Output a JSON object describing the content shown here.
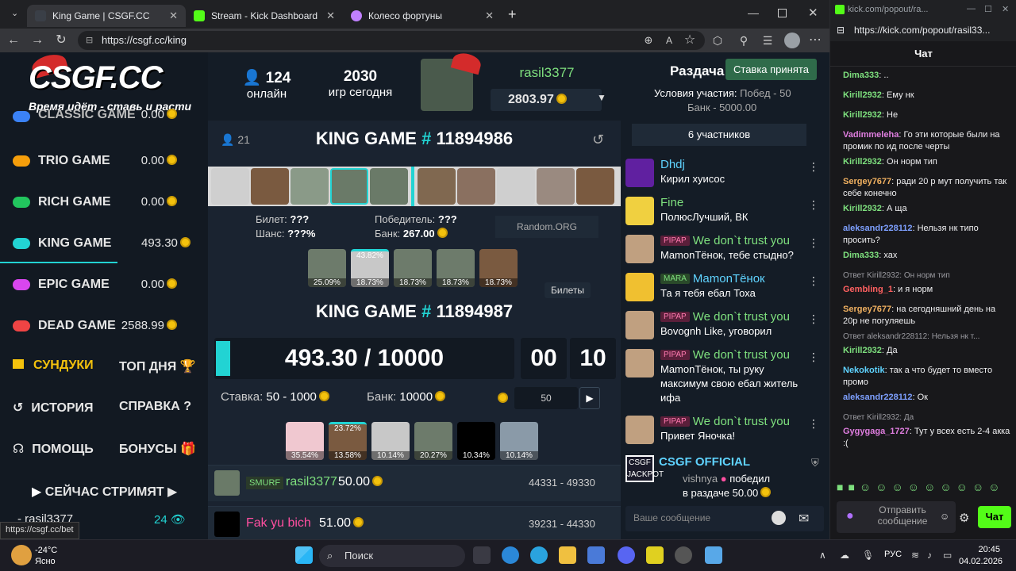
{
  "browser": {
    "tabs": [
      {
        "title": "King Game | CSGF.CC",
        "active": true
      },
      {
        "title": "Stream - Kick Dashboard",
        "active": false
      },
      {
        "title": "Колесо фортуны",
        "active": false
      }
    ],
    "url": "https://csgf.cc/king",
    "status_url": "https://csgf.cc/bet"
  },
  "sidebar": {
    "logo": "CSGF.CC",
    "logo_sub": "Время идёт - ставь и расти",
    "items": [
      {
        "label": "CLASSIC GAME",
        "value": "0.00",
        "color": "#3b82f6"
      },
      {
        "label": "TRIO GAME",
        "value": "0.00",
        "color": "#f59e0b"
      },
      {
        "label": "RICH GAME",
        "value": "0.00",
        "color": "#22c55e"
      },
      {
        "label": "KING GAME",
        "value": "493.30",
        "color": "#22d3d3"
      },
      {
        "label": "EPIC GAME",
        "value": "0.00",
        "color": "#d946ef"
      },
      {
        "label": "DEAD GAME",
        "value": "2588.99",
        "color": "#ef4444"
      }
    ],
    "row1": {
      "left": "СУНДУКИ",
      "right": "ТОП ДНЯ"
    },
    "row2": {
      "left": "ИСТОРИЯ",
      "right": "СПРАВКА"
    },
    "row3": {
      "left": "ПОМОЩЬ",
      "right": "БОНУСЫ"
    },
    "streaming": "СЕЙЧАС СТРИМЯТ",
    "streamer": {
      "name": "- rasil3377",
      "viewers": "24"
    }
  },
  "header": {
    "online_count": "124",
    "online_label": "онлайн",
    "games_count": "2030",
    "games_label": "игр сегодня",
    "username": "rasil3377",
    "balance": "2803.97"
  },
  "game_prev": {
    "players": "21",
    "title_prefix": "KING GAME ",
    "hash": "#",
    "number": " 11894986",
    "ticket_label": "Билет:",
    "ticket_value": "???",
    "chance_label": "Шанс:",
    "chance_value": "???%",
    "winner_label": "Победитель:",
    "winner_value": "???",
    "bank_label": "Банк:",
    "bank_value": "267.00",
    "random_org": "Random.ORG",
    "top_pct": "43.82%",
    "chances": [
      "25.09%",
      "18.73%",
      "18.73%",
      "18.73%",
      "18.73%"
    ],
    "tickets_tooltip": "Билеты"
  },
  "game_next": {
    "title_prefix": "KING GAME ",
    "hash": "#",
    "number": " 11894987",
    "progress": "493.30 / 10000",
    "progress_fraction": 0.0493,
    "timer_min": "00",
    "timer_sec": "10",
    "bet_label": "Ставка:",
    "bet_range": "50 - 1000",
    "bank_label": "Банк:",
    "bank_value": "10000",
    "bet_input": "50",
    "top_pct": "23.72%",
    "chances": [
      "35.54%",
      "13.58%",
      "10.14%",
      "20.27%",
      "10.34%",
      "10.14%"
    ],
    "bets": [
      {
        "badge": "SMURF",
        "name": "rasil3377",
        "amount": "50.00",
        "range": "44331 - 49330"
      },
      {
        "badge": "",
        "name": "Fak yu bich",
        "amount": "51.00",
        "range": "39231 - 44330"
      }
    ]
  },
  "giveaway": {
    "title": "Раздача:",
    "accepted": "Ставка принята",
    "conditions_label": "Условия участия:",
    "conditions_value": "Побед - 50",
    "bank": "Банк - 5000.00",
    "participants": "6 участников"
  },
  "site_chat": {
    "messages": [
      {
        "badge": "",
        "name": "Dhdj",
        "text": "Кирил хуисос",
        "name_color": "#5fd3ff"
      },
      {
        "badge": "",
        "name": "Fine",
        "text": "ПолюсЛучший, ВК",
        "name_color": "#7ee07e"
      },
      {
        "badge": "PIPAP",
        "name": "We don`t trust you",
        "text": "MamonTёнок, тебе стыдно?",
        "name_color": "#7ee07e"
      },
      {
        "badge": "MARA",
        "name": "MamonTёнок",
        "text": "Та я тебя ебал Тоха",
        "name_color": "#5fd3ff"
      },
      {
        "badge": "PIPAP",
        "name": "We don`t trust you",
        "text": "Bovognh Like, уговорил",
        "name_color": "#7ee07e"
      },
      {
        "badge": "PIPAP",
        "name": "We don`t trust you",
        "text": "MamonTёнок, ты руку",
        "text2": "максимум свою ебал житель",
        "text3": "ифа",
        "name_color": "#7ee07e"
      },
      {
        "badge": "PIPAP",
        "name": "We don`t trust you",
        "text": "Привет Яночка!",
        "name_color": "#7ee07e"
      }
    ],
    "official": {
      "name": "CSGF OFFICIAL",
      "winner": "vishnya",
      "text": "победил",
      "prize_prefix": "в раздаче",
      "prize": "50.00"
    },
    "placeholder": "Ваше сообщение"
  },
  "kick": {
    "url_short": "kick.com/popout/ra...",
    "url": "https://kick.com/popout/rasil33...",
    "title": "Чат",
    "lines": [
      {
        "user": "Dima333",
        "text": " ..",
        "color": "#7ee07e"
      },
      {
        "user": "Kirill2932",
        "text": " Ему нк",
        "color": "#7ee07e"
      },
      {
        "user": "Kirill2932",
        "text": " Не",
        "color": "#7ee07e"
      },
      {
        "user": "Vadimmeleha",
        "text": " Го эти которые были на промик по ид после черты",
        "color": "#e07ee0"
      },
      {
        "user": "Kirill2932",
        "text": " Он норм тип",
        "color": "#7ee07e"
      },
      {
        "user": "Sergey7677",
        "text": " ради 20 р мут получить так себе конечно",
        "color": "#f0b060"
      },
      {
        "user": "Kirill2932",
        "text": " А ща",
        "color": "#7ee07e"
      },
      {
        "user": "aleksandr228112",
        "text": " Нельзя нк типо просить?",
        "color": "#7ea0ff"
      },
      {
        "user": "Dima333",
        "text": " хах",
        "color": "#7ee07e"
      },
      {
        "reply": "Ответ Kirill2932: Он норм тип"
      },
      {
        "user": "Gembling_1",
        "text": " и я норм",
        "color": "#ff6060"
      },
      {
        "user": "Sergey7677",
        "text": " на сегодняшний день на 20р не погуляешь",
        "color": "#f0b060"
      },
      {
        "reply": "Ответ aleksandr228112: Нельзя нк т..."
      },
      {
        "user": "Kirill2932",
        "text": " Да",
        "color": "#7ee07e"
      },
      {
        "user": "Nekokotik",
        "text": " так а что будет то вместо промо",
        "color": "#5fd3ff"
      },
      {
        "user": "aleksandr228112",
        "text": " Ок",
        "color": "#7ea0ff"
      },
      {
        "reply": "Ответ Kirill2932: Да"
      },
      {
        "user": "Gygygaga_1727",
        "text": " Тут у всех есть 2-4 акка :(",
        "color": "#e07ee0"
      }
    ],
    "send_label": "Отправить сообщение",
    "chat_button": "Чат"
  },
  "taskbar": {
    "weather_temp": "-24°C",
    "weather_text": "Ясно",
    "search": "Поиск",
    "lang": "РУС",
    "time": "20:45",
    "date": "04.02.2026"
  }
}
